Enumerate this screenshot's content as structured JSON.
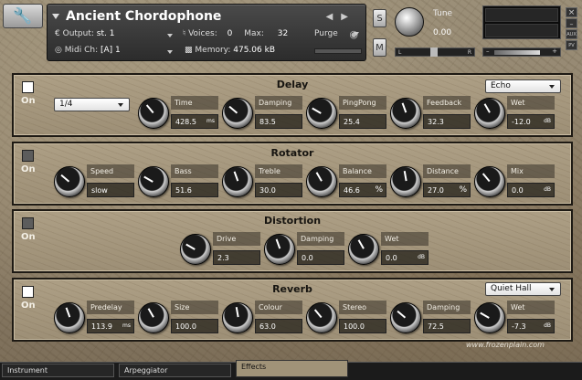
{
  "header": {
    "instrument_name": "Ancient Chordophone",
    "output_label": "Output:",
    "output_value": "st. 1",
    "voices_label": "Voices:",
    "voices_value": "0",
    "max_label": "Max:",
    "max_value": "32",
    "purge_label": "Purge",
    "midi_label": "Midi Ch:",
    "midi_value": "[A]  1",
    "memory_label": "Memory:",
    "memory_value": "475.06 kB",
    "solo_label": "S",
    "mute_label": "M",
    "tune_label": "Tune",
    "tune_value": "0.00",
    "pan_left": "L",
    "pan_right": "R",
    "aux_label": "AUX",
    "pv_label": "PV"
  },
  "modules": [
    {
      "title": "Delay",
      "enabled": true,
      "on_label": "On",
      "rate": "1/4",
      "mode": "Echo",
      "controls": [
        {
          "label": "Time",
          "value": "428.5",
          "unit": "ms"
        },
        {
          "label": "Damping",
          "value": "83.5",
          "unit": ""
        },
        {
          "label": "PingPong",
          "value": "25.4",
          "unit": ""
        },
        {
          "label": "Feedback",
          "value": "32.3",
          "unit": ""
        },
        {
          "label": "Wet",
          "value": "-12.0",
          "unit": "dB"
        }
      ]
    },
    {
      "title": "Rotator",
      "enabled": false,
      "on_label": "On",
      "controls": [
        {
          "label": "Speed",
          "value": "slow",
          "unit": ""
        },
        {
          "label": "Bass",
          "value": "51.6",
          "unit": ""
        },
        {
          "label": "Treble",
          "value": "30.0",
          "unit": ""
        },
        {
          "label": "Balance",
          "value": "46.6",
          "unit": "%"
        },
        {
          "label": "Distance",
          "value": "27.0",
          "unit": "%"
        },
        {
          "label": "Mix",
          "value": "0.0",
          "unit": "dB"
        }
      ]
    },
    {
      "title": "Distortion",
      "enabled": false,
      "on_label": "On",
      "controls": [
        {
          "label": "Drive",
          "value": "2.3",
          "unit": ""
        },
        {
          "label": "Damping",
          "value": "0.0",
          "unit": ""
        },
        {
          "label": "Wet",
          "value": "0.0",
          "unit": "dB"
        }
      ]
    },
    {
      "title": "Reverb",
      "enabled": true,
      "on_label": "On",
      "mode": "Quiet Hall",
      "controls": [
        {
          "label": "Predelay",
          "value": "113.9",
          "unit": "ms"
        },
        {
          "label": "Size",
          "value": "100.0",
          "unit": ""
        },
        {
          "label": "Colour",
          "value": "63.0",
          "unit": ""
        },
        {
          "label": "Stereo",
          "value": "100.0",
          "unit": ""
        },
        {
          "label": "Damping",
          "value": "72.5",
          "unit": ""
        },
        {
          "label": "Wet",
          "value": "-7.3",
          "unit": "dB"
        }
      ]
    }
  ],
  "credit": "www.frozenplain.com",
  "tabs": [
    {
      "label": "Instrument",
      "active": false
    },
    {
      "label": "Arpeggiator",
      "active": false
    },
    {
      "label": "Effects",
      "active": true
    }
  ]
}
